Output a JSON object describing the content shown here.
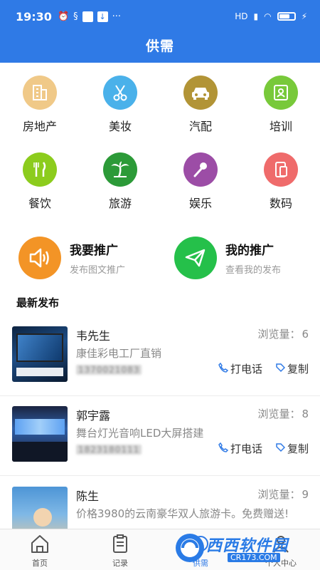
{
  "status_bar": {
    "time": "19:30",
    "net": "HD"
  },
  "header": {
    "title": "供需"
  },
  "categories": [
    {
      "label": "房地产",
      "icon": "building-icon",
      "color": "#f0c988"
    },
    {
      "label": "美妆",
      "icon": "scissors-icon",
      "color": "#4ab1ea"
    },
    {
      "label": "汽配",
      "icon": "car-icon",
      "color": "#b29436"
    },
    {
      "label": "培训",
      "icon": "id-card-icon",
      "color": "#78c93a"
    },
    {
      "label": "餐饮",
      "icon": "utensils-icon",
      "color": "#8ccc1d"
    },
    {
      "label": "旅游",
      "icon": "palm-tree-icon",
      "color": "#2c9a38"
    },
    {
      "label": "娱乐",
      "icon": "microphone-icon",
      "color": "#9c4da6"
    },
    {
      "label": "数码",
      "icon": "devices-icon",
      "color": "#ef6b6b"
    }
  ],
  "promo": {
    "left": {
      "title": "我要推广",
      "subtitle": "发布图文推广",
      "icon": "speaker-icon",
      "color": "#f39426"
    },
    "right": {
      "title": "我的推广",
      "subtitle": "查看我的发布",
      "icon": "paper-plane-icon",
      "color": "#25c04a"
    }
  },
  "section": {
    "title": "最新发布"
  },
  "list_labels": {
    "views_label": "浏览量：",
    "call_label": "打电话",
    "copy_label": "复制"
  },
  "items": [
    {
      "name": "韦先生",
      "views": "6",
      "desc": "康佳彩电工厂直销",
      "phone": "1370021083"
    },
    {
      "name": "郭宇露",
      "views": "8",
      "desc": "舞台灯光音响LED大屏搭建",
      "phone": "1823180111"
    },
    {
      "name": "陈生",
      "views": "9",
      "desc": "价格3980的云南豪华双人旅游卡。免费赠送!",
      "phone": ""
    }
  ],
  "bottom_nav": [
    {
      "label": "首页",
      "icon": "home-icon"
    },
    {
      "label": "记录",
      "icon": "clipboard-icon"
    },
    {
      "label": "供需",
      "icon": "supply-icon"
    },
    {
      "label": "个人中心",
      "icon": "user-icon"
    }
  ],
  "watermark": {
    "text": "西西软件园",
    "url": "CR173.COM"
  },
  "colors": {
    "accent": "#2f7ae6"
  }
}
